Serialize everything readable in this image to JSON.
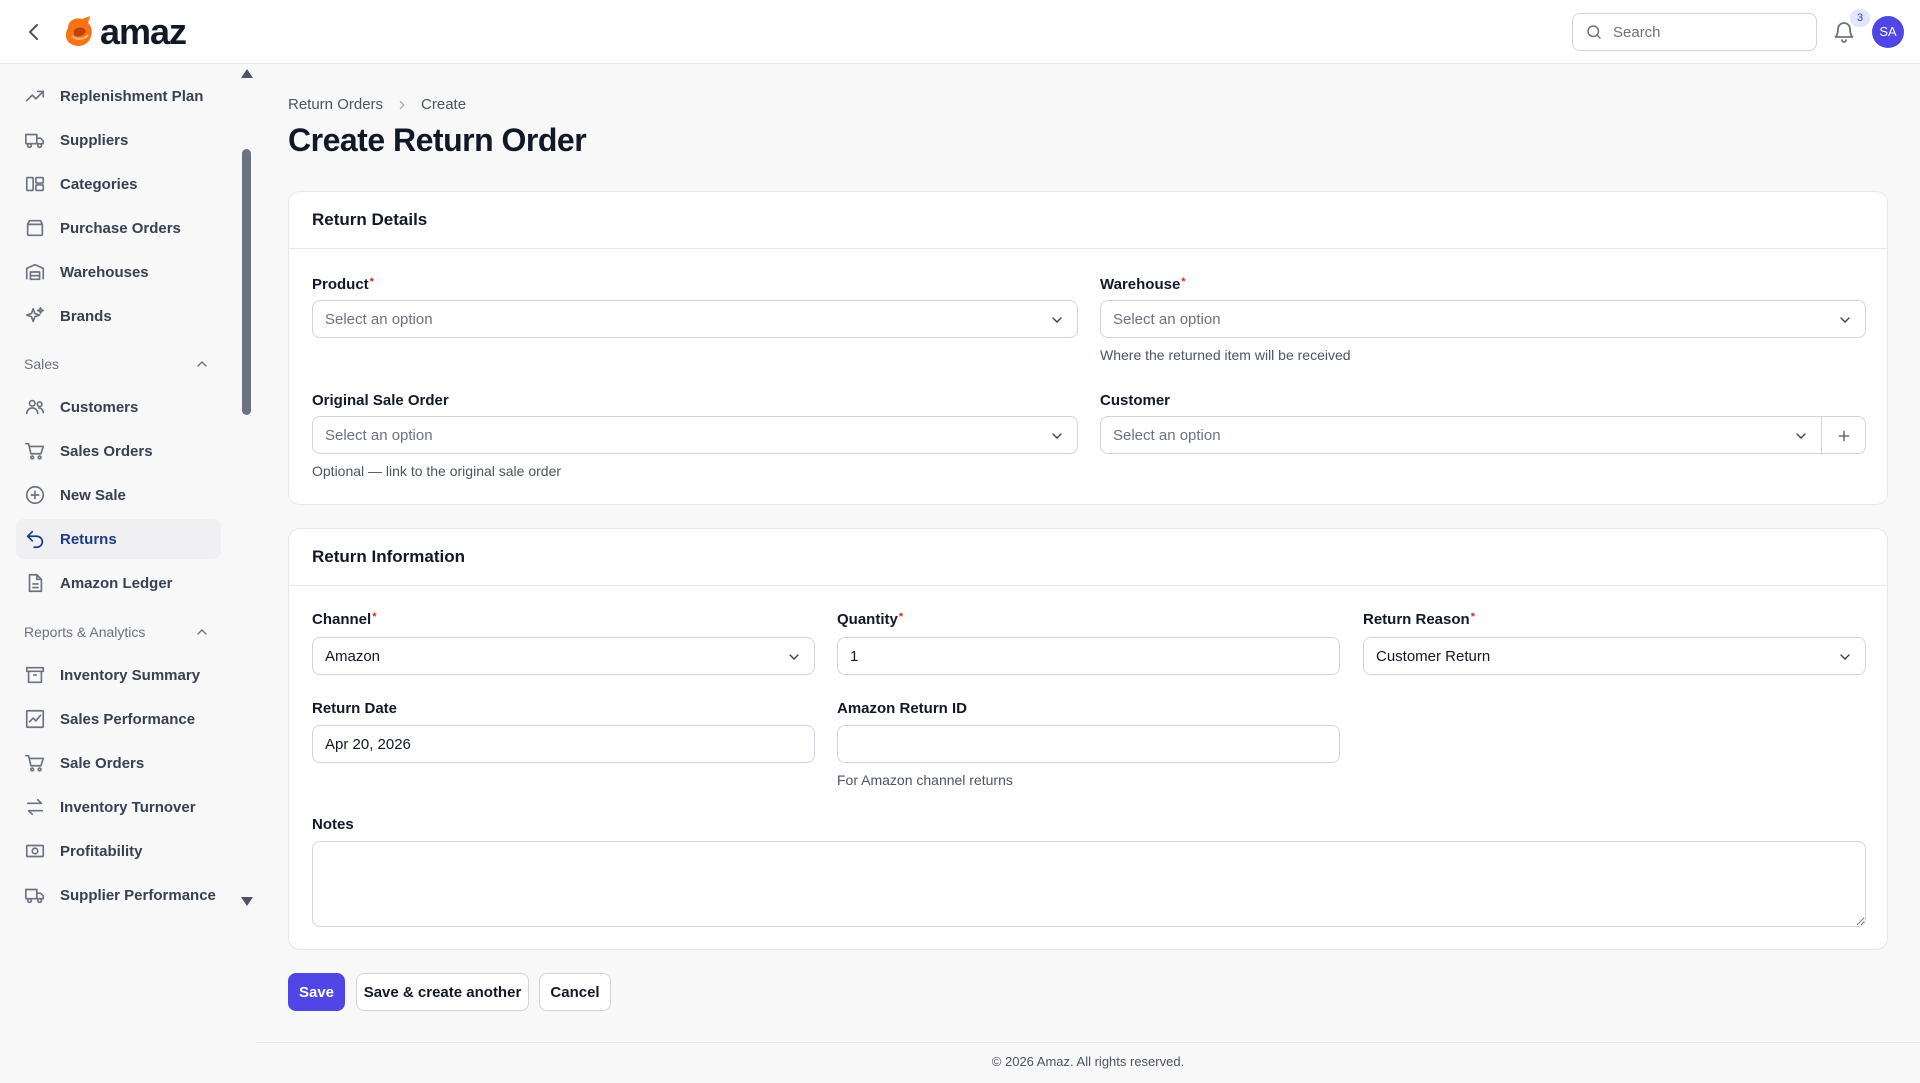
{
  "app": {
    "logo_text": "amaz",
    "search_placeholder": "Search",
    "notification_count": "3",
    "avatar_initials": "SA"
  },
  "sidebar": {
    "items_top": [
      {
        "label": "Replenishment Plan",
        "icon": "trending-up-icon"
      },
      {
        "label": "Suppliers",
        "icon": "truck-icon"
      },
      {
        "label": "Categories",
        "icon": "categories-icon"
      },
      {
        "label": "Purchase Orders",
        "icon": "archive-icon"
      },
      {
        "label": "Warehouses",
        "icon": "building-icon"
      },
      {
        "label": "Brands",
        "icon": "sparkles-icon"
      }
    ],
    "group_sales": "Sales",
    "items_sales": [
      {
        "label": "Customers",
        "icon": "users-icon"
      },
      {
        "label": "Sales Orders",
        "icon": "cart-icon"
      },
      {
        "label": "New Sale",
        "icon": "plus-circle-icon"
      },
      {
        "label": "Returns",
        "icon": "return-arrow-icon",
        "active": true
      },
      {
        "label": "Amazon Ledger",
        "icon": "document-icon"
      }
    ],
    "group_reports": "Reports & Analytics",
    "items_reports": [
      {
        "label": "Inventory Summary",
        "icon": "archive-box-icon"
      },
      {
        "label": "Sales Performance",
        "icon": "chart-icon"
      },
      {
        "label": "Sale Orders",
        "icon": "cart-icon"
      },
      {
        "label": "Inventory Turnover",
        "icon": "arrows-exchange-icon"
      },
      {
        "label": "Profitability",
        "icon": "banknote-icon"
      },
      {
        "label": "Supplier Performance",
        "icon": "truck-icon"
      }
    ]
  },
  "breadcrumb": {
    "parent": "Return Orders",
    "current": "Create"
  },
  "page_title": "Create Return Order",
  "return_details": {
    "title": "Return Details",
    "product": {
      "label": "Product",
      "placeholder": "Select an option",
      "required": true
    },
    "warehouse": {
      "label": "Warehouse",
      "placeholder": "Select an option",
      "required": true,
      "helper": "Where the returned item will be received"
    },
    "original_sale_order": {
      "label": "Original Sale Order",
      "placeholder": "Select an option",
      "helper": "Optional — link to the original sale order"
    },
    "customer": {
      "label": "Customer",
      "placeholder": "Select an option"
    }
  },
  "return_information": {
    "title": "Return Information",
    "channel": {
      "label": "Channel",
      "value": "Amazon",
      "required": true
    },
    "quantity": {
      "label": "Quantity",
      "value": "1",
      "required": true
    },
    "return_reason": {
      "label": "Return Reason",
      "value": "Customer Return",
      "required": true
    },
    "return_date": {
      "label": "Return Date",
      "value": "Apr 20, 2026"
    },
    "amazon_return_id": {
      "label": "Amazon Return ID",
      "value": "",
      "helper": "For Amazon channel returns"
    },
    "notes": {
      "label": "Notes",
      "value": ""
    }
  },
  "actions": {
    "save": "Save",
    "save_another": "Save & create another",
    "cancel": "Cancel"
  },
  "footer": "© 2026 Amaz. All rights reserved.",
  "colors": {
    "primary": "#4f46e5",
    "required": "#dc2626",
    "active_nav": "#1e3a8a"
  }
}
